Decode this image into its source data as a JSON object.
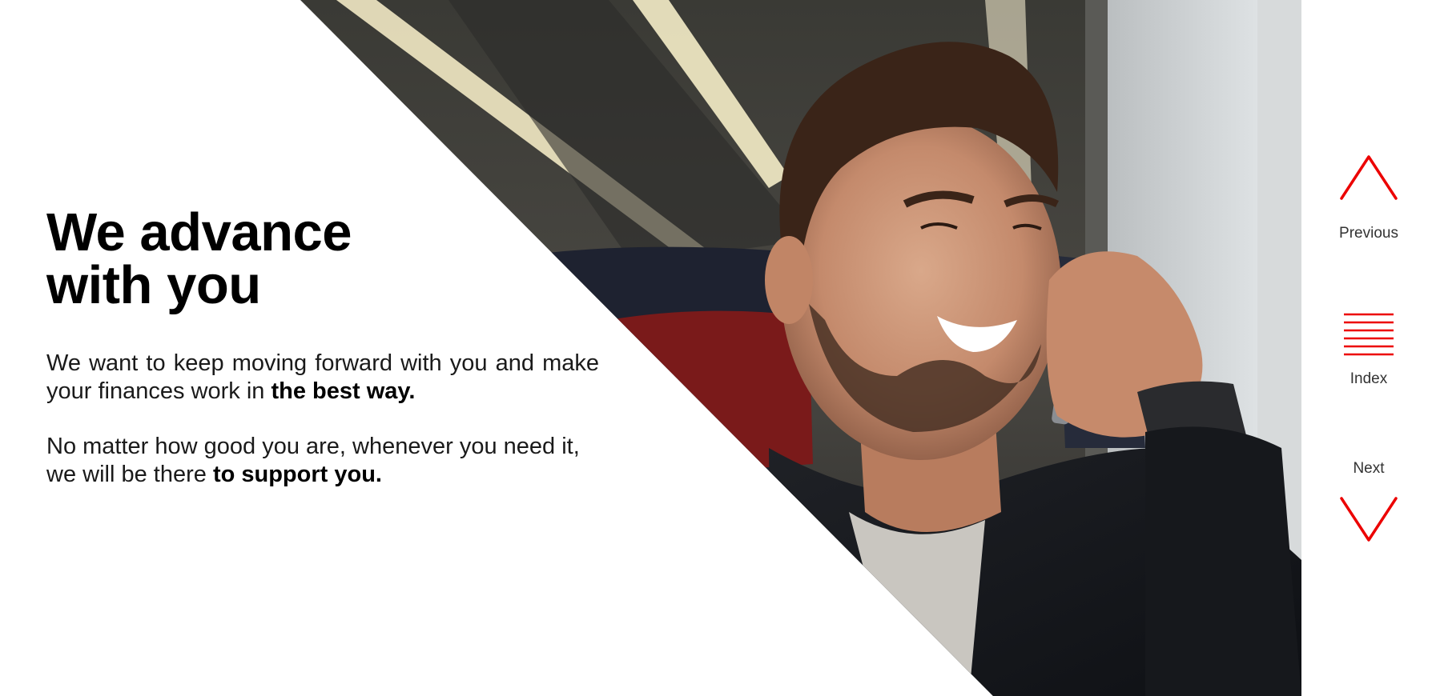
{
  "headline": {
    "line1": "We advance",
    "line2": "with you"
  },
  "paragraph1": {
    "text": "We want to keep moving forward with you and make your finances work in ",
    "bold": "the best way."
  },
  "paragraph2": {
    "text": "No matter how good you are, whenever you need it, we will be there ",
    "bold": "to support you."
  },
  "nav": {
    "previous_label": "Previous",
    "index_label": "Index",
    "next_label": "Next",
    "previous_icon": "chevron-up-icon",
    "index_icon": "index-lines-icon",
    "next_icon": "chevron-down-icon"
  },
  "photo": {
    "subject": "man-on-phone-photo"
  },
  "colors": {
    "accent": "#ec0000",
    "text": "#000000",
    "background": "#ffffff"
  }
}
